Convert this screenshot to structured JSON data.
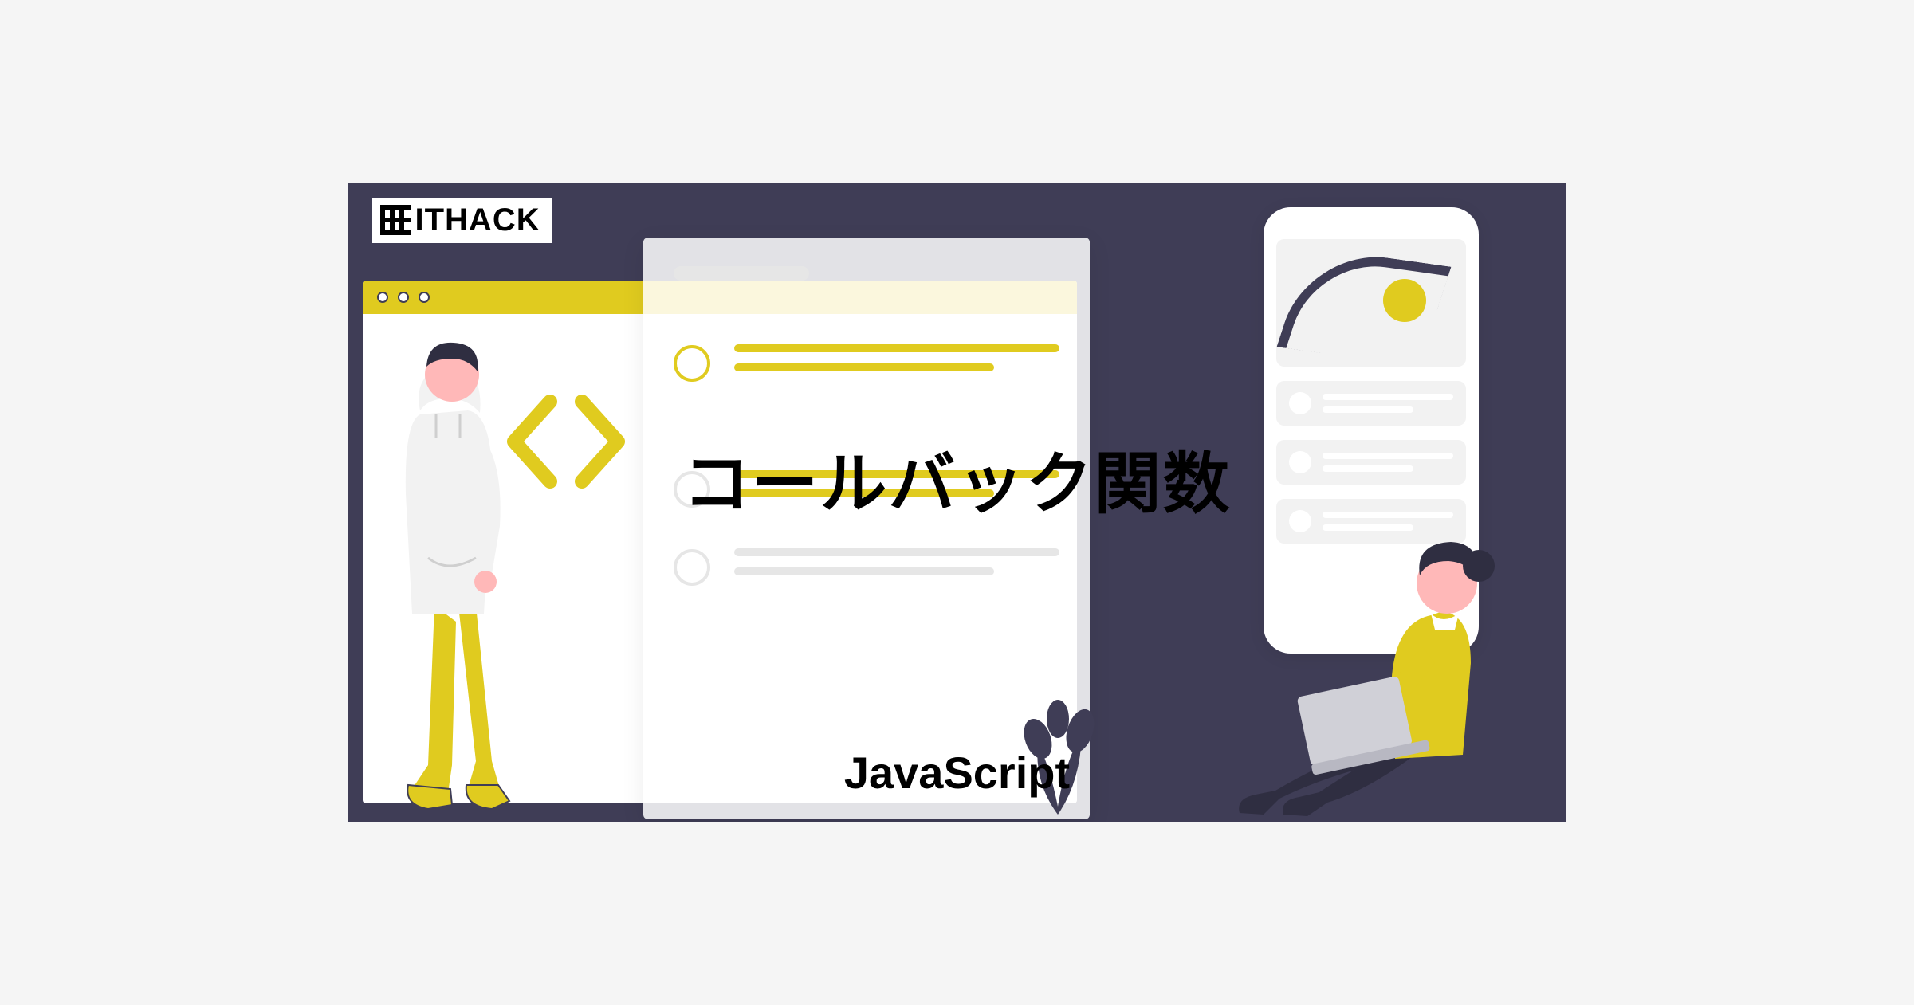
{
  "logo_text": "ITHACK",
  "title": "コールバック関数",
  "subtitle": "JavaScript",
  "colors": {
    "background": "#3F3D56",
    "accent": "#E0CB1F",
    "skin": "#FFB8B8",
    "white": "#FFFFFF",
    "grey": "#E6E6E6"
  }
}
